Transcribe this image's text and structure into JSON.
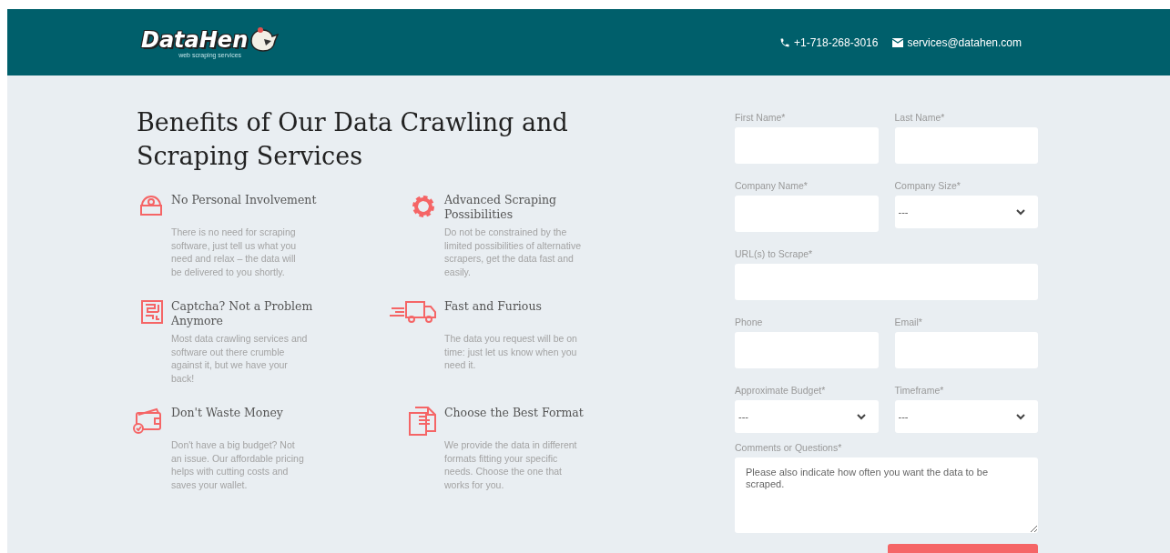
{
  "header": {
    "logo": {
      "name": "DataHen",
      "tagline": "web scraping services"
    },
    "phone": "+1-718-268-3016",
    "email": "services@datahen.com"
  },
  "heading": "Benefits of Our Data Crawling and Scraping Services",
  "features": [
    {
      "title": "No Personal Involvement",
      "text": "There is no need for scraping software, just tell us what you need and relax – the data will be delivered to you shortly."
    },
    {
      "title": "Advanced Scraping Possibilities",
      "text": "Do not be constrained by the limited possibilities of alternative scrapers, get the data fast and easily."
    },
    {
      "title": "Captcha? Not a Problem Anymore",
      "text": "Most data crawling services and software out there crumble against it, but we have your back!"
    },
    {
      "title": "Fast and Furious",
      "text": "The data you request will be on time: just let us know when you need it."
    },
    {
      "title": "Don't Waste Money",
      "text": "Don't have a big budget? Not an issue. Our affordable pricing helps with cutting costs and saves your wallet."
    },
    {
      "title": "Choose the Best Format",
      "text": "We provide the data in different formats fitting your specific needs. Choose the one that works for you."
    }
  ],
  "form": {
    "rows": [
      [
        {
          "kind": "input",
          "label": "First Name*"
        },
        {
          "kind": "input",
          "label": "Last Name*"
        }
      ],
      [
        {
          "kind": "input",
          "label": "Company Name*"
        },
        {
          "kind": "select",
          "label": "Company Size*",
          "value": "---"
        }
      ],
      [
        {
          "kind": "input",
          "label": "URL(s) to Scrape*"
        }
      ],
      [
        {
          "kind": "input",
          "label": "Phone"
        },
        {
          "kind": "input",
          "label": "Email*"
        }
      ],
      [
        {
          "kind": "select",
          "label": "Approximate Budget*",
          "value": "---"
        },
        {
          "kind": "select",
          "label": "Timeframe*",
          "value": "---"
        }
      ],
      [
        {
          "kind": "textarea",
          "label": "Comments or Questions*",
          "placeholder": "Please also indicate how often you want the data to be scraped."
        }
      ]
    ]
  }
}
